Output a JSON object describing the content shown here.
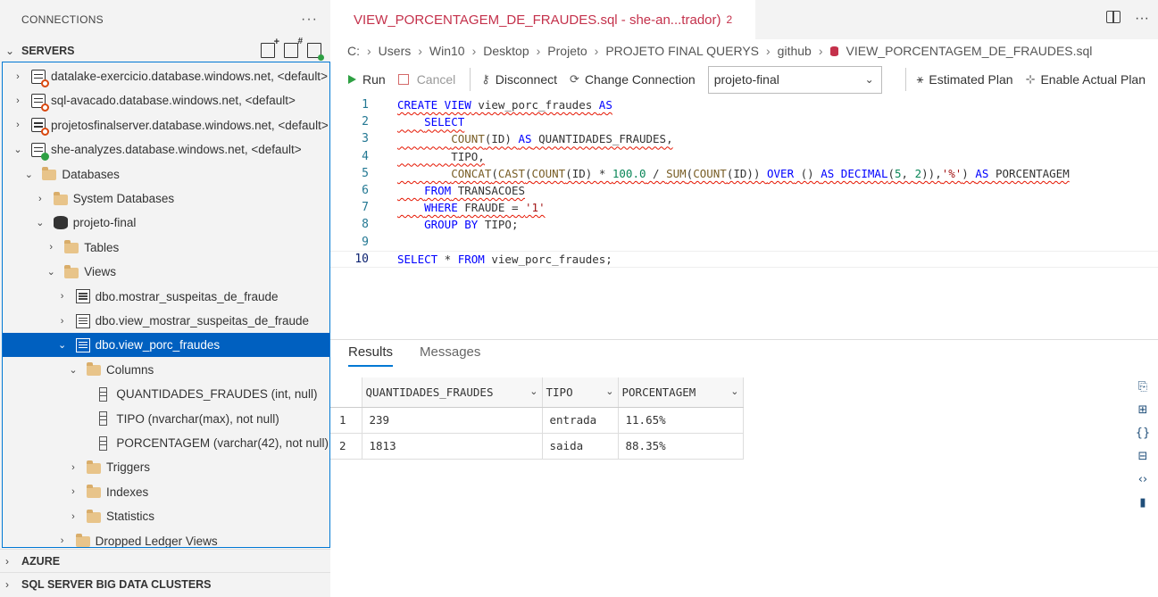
{
  "sidebar": {
    "title": "CONNECTIONS",
    "servers_label": "SERVERS",
    "bottom_sections": [
      "AZURE",
      "SQL SERVER BIG DATA CLUSTERS"
    ],
    "tree": [
      {
        "label": "datalake-exercicio.database.windows.net, <default>",
        "chev": "›",
        "indent": 0,
        "icon": "server"
      },
      {
        "label": "sql-avacado.database.windows.net, <default>",
        "chev": "›",
        "indent": 0,
        "icon": "server"
      },
      {
        "label": "projetosfinalserver.database.windows.net, <default>",
        "chev": "›",
        "indent": 0,
        "icon": "server"
      },
      {
        "label": "she-analyzes.database.windows.net, <default>",
        "chev": "⌄",
        "indent": 0,
        "icon": "server-connected"
      },
      {
        "label": "Databases",
        "chev": "⌄",
        "indent": 1,
        "icon": "folder"
      },
      {
        "label": "System Databases",
        "chev": "›",
        "indent": 2,
        "icon": "folder"
      },
      {
        "label": "projeto-final",
        "chev": "⌄",
        "indent": 2,
        "icon": "database"
      },
      {
        "label": "Tables",
        "chev": "›",
        "indent": 3,
        "icon": "folder"
      },
      {
        "label": "Views",
        "chev": "⌄",
        "indent": 3,
        "icon": "folder"
      },
      {
        "label": "dbo.mostrar_suspeitas_de_fraude",
        "chev": "›",
        "indent": 4,
        "icon": "view"
      },
      {
        "label": "dbo.view_mostrar_suspeitas_de_fraude",
        "chev": "›",
        "indent": 4,
        "icon": "view"
      },
      {
        "label": "dbo.view_porc_fraudes",
        "chev": "⌄",
        "indent": 4,
        "icon": "view",
        "selected": true
      },
      {
        "label": "Columns",
        "chev": "⌄",
        "indent": 5,
        "icon": "folder"
      },
      {
        "label": "QUANTIDADES_FRAUDES (int, null)",
        "chev": "",
        "indent": 6,
        "icon": "column"
      },
      {
        "label": "TIPO (nvarchar(max), not null)",
        "chev": "",
        "indent": 6,
        "icon": "column"
      },
      {
        "label": "PORCENTAGEM (varchar(42), not null)",
        "chev": "",
        "indent": 6,
        "icon": "column"
      },
      {
        "label": "Triggers",
        "chev": "›",
        "indent": 5,
        "icon": "folder"
      },
      {
        "label": "Indexes",
        "chev": "›",
        "indent": 5,
        "icon": "folder"
      },
      {
        "label": "Statistics",
        "chev": "›",
        "indent": 5,
        "icon": "folder"
      },
      {
        "label": "Dropped Ledger Views",
        "chev": "›",
        "indent": 4,
        "icon": "folder"
      }
    ]
  },
  "tab": {
    "title": "VIEW_PORCENTAGEM_DE_FRAUDES.sql - she-an...trador)",
    "problems": "2"
  },
  "breadcrumb": [
    "C:",
    "Users",
    "Win10",
    "Desktop",
    "Projeto",
    "PROJETO FINAL QUERYS",
    "github",
    "VIEW_PORCENTAGEM_DE_FRAUDES.sql"
  ],
  "toolbar": {
    "run": "Run",
    "cancel": "Cancel",
    "disconnect": "Disconnect",
    "change_connection": "Change Connection",
    "database": "projeto-final",
    "estimated_plan": "Estimated Plan",
    "actual_plan": "Enable Actual Plan"
  },
  "code_lines": [
    "CREATE VIEW view_porc_fraudes AS",
    "    SELECT",
    "        COUNT(ID) AS QUANTIDADES_FRAUDES,",
    "        TIPO,",
    "        CONCAT(CAST(COUNT(ID) * 100.0 / SUM(COUNT(ID)) OVER () AS DECIMAL(5, 2)),'%') AS PORCENTAGEM",
    "    FROM TRANSACOES",
    "    WHERE FRAUDE = '1'",
    "    GROUP BY TIPO;",
    "",
    "SELECT * FROM view_porc_fraudes;"
  ],
  "results": {
    "tabs": [
      "Results",
      "Messages"
    ],
    "columns": [
      "QUANTIDADES_FRAUDES",
      "TIPO",
      "PORCENTAGEM"
    ],
    "rows": [
      {
        "n": "1",
        "cells": [
          "239",
          "entrada",
          "11.65%"
        ]
      },
      {
        "n": "2",
        "cells": [
          "1813",
          "saida",
          "88.35%"
        ]
      }
    ]
  },
  "side_tools": [
    "save-as-csv-icon",
    "save-as-excel-icon",
    "save-as-json-icon",
    "save-as-xml-icon",
    "copy-icon",
    "chart-icon"
  ]
}
